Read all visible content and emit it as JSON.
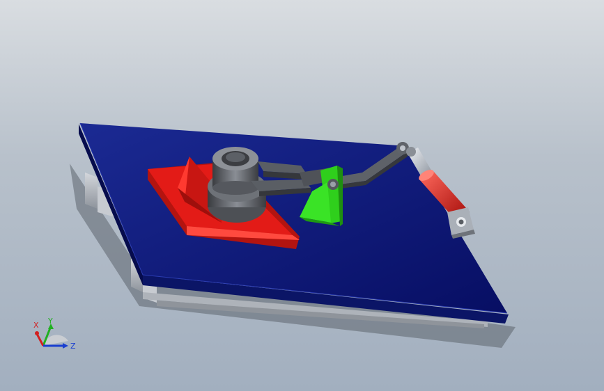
{
  "viewport": {
    "background_top": "#d9dde1",
    "background_bottom": "#a2afbf"
  },
  "model": {
    "parts": [
      {
        "name": "base-plate",
        "color": "#0a1a78"
      },
      {
        "name": "fixture-block",
        "color": "#e31b17"
      },
      {
        "name": "workpiece-ring",
        "color": "#5a5d63"
      },
      {
        "name": "linkage-arms",
        "color": "#4a4d52"
      },
      {
        "name": "pivot-bracket",
        "color": "#2fcf1c"
      },
      {
        "name": "cylinder-rod",
        "color": "#c9cfd8"
      },
      {
        "name": "cylinder-body",
        "color": "#e0302c"
      },
      {
        "name": "cylinder-mount",
        "color": "#9aa0a8"
      }
    ]
  },
  "triad": {
    "x_label": "X",
    "y_label": "Y",
    "z_label": "Z",
    "x_color": "#d22020",
    "y_color": "#20b020",
    "z_color": "#1a3fd0"
  }
}
